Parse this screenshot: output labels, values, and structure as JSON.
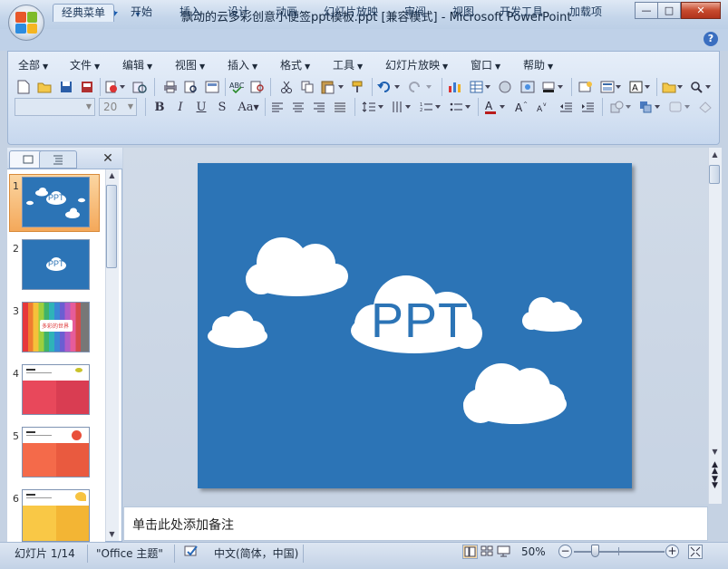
{
  "window": {
    "title": "飘动的云多彩创意小便签ppt模板.ppt [兼容模式] - Microsoft PowerPoint",
    "minimize": "—",
    "maximize": "□",
    "close": "✕"
  },
  "quick_access": {
    "save": "save-icon",
    "undo": "undo-icon",
    "redo": "redo-icon",
    "customize": "▾"
  },
  "tabs": [
    "经典菜单",
    "开始",
    "插入",
    "设计",
    "动画",
    "幻灯片放映",
    "审阅",
    "视图",
    "开发工具",
    "加载项"
  ],
  "active_tab": "经典菜单",
  "help": "?",
  "menus": [
    "全部",
    "文件",
    "编辑",
    "视图",
    "插入",
    "格式",
    "工具",
    "幻灯片放映",
    "窗口",
    "帮助"
  ],
  "format_bar": {
    "font_name": "",
    "font_size": "20",
    "bold": "B",
    "italic": "I",
    "underline": "U",
    "strike": "S",
    "case": "Aa"
  },
  "slides": [
    {
      "number": "1",
      "label": "PPT"
    },
    {
      "number": "2",
      "label": "PPT"
    },
    {
      "number": "3",
      "label": "多彩的世界"
    },
    {
      "number": "4",
      "label": ""
    },
    {
      "number": "5",
      "label": ""
    },
    {
      "number": "6",
      "label": ""
    }
  ],
  "selected_slide": "1",
  "slide_title": "PPT",
  "notes_placeholder": "单击此处添加备注",
  "status": {
    "slide_info": "幻灯片 1/14",
    "theme": "\"Office 主题\"",
    "language": "中文(简体，中国)",
    "zoom": "50%"
  },
  "colors": {
    "slide_bg": "#2c74b6",
    "cloud": "#ffffff",
    "accent_orange": "#f4a85a"
  }
}
